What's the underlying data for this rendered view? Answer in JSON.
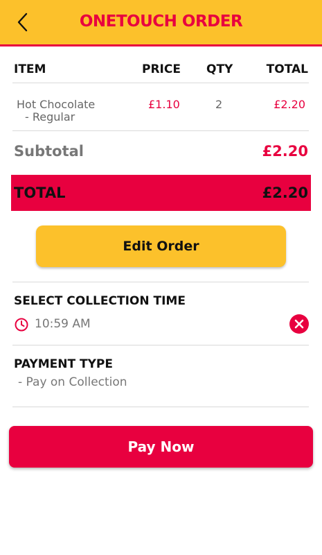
{
  "header": {
    "title": "ONETOUCH ORDER"
  },
  "table": {
    "columns": {
      "item": "ITEM",
      "price": "PRICE",
      "qty": "QTY",
      "total": "TOTAL"
    },
    "rows": [
      {
        "item_line1": "Hot Chocolate",
        "item_line2": "- Regular",
        "price": "£1.10",
        "qty": "2",
        "total": "£2.20"
      }
    ]
  },
  "summary": {
    "subtotal_label": "Subtotal",
    "subtotal_value": "£2.20",
    "total_label": "TOTAL",
    "total_value": "£2.20"
  },
  "edit_button": "Edit Order",
  "collection": {
    "title": "SELECT COLLECTION TIME",
    "time": "10:59 AM"
  },
  "payment": {
    "title": "PAYMENT TYPE",
    "value": "- Pay on Collection"
  },
  "pay_button": "Pay Now",
  "colors": {
    "accent_red": "#e8003f",
    "accent_yellow": "#fcc12b"
  },
  "icons": {
    "back": "back-arrow-icon",
    "clock": "clock-icon",
    "clear": "clear-icon"
  }
}
